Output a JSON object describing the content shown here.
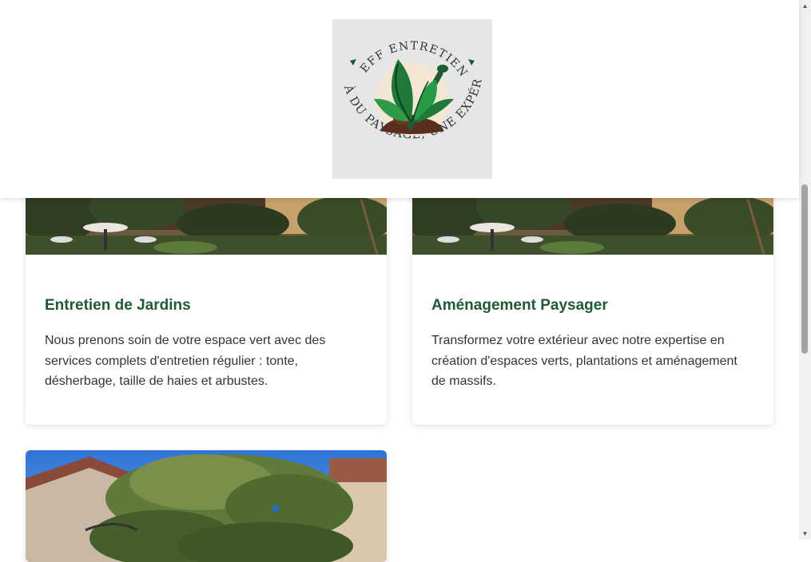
{
  "logo": {
    "top_text": "JEFF ENTRETIEN",
    "bottom_text": "AU DELÀ DU PAYSAGE, UNE EXPÉRIENCE",
    "icon": "plant-trowel-icon"
  },
  "services": [
    {
      "title": "Entretien de Jardins",
      "description": "Nous prenons soin de votre espace vert avec des services complets d'entretien régulier : tonte, désherbage, taille de haies et arbustes.",
      "image": "garden-terrace-photo"
    },
    {
      "title": "Aménagement Paysager",
      "description": "Transformez votre extérieur avec notre expertise en création d'espaces verts, plantations et aménagement de massifs.",
      "image": "garden-terrace-photo"
    },
    {
      "image": "cedar-tree-house-photo"
    }
  ],
  "colors": {
    "accent_green": "#1f5b32",
    "logo_background": "#e6e6e6",
    "soil_brown": "#5a2e1f"
  }
}
